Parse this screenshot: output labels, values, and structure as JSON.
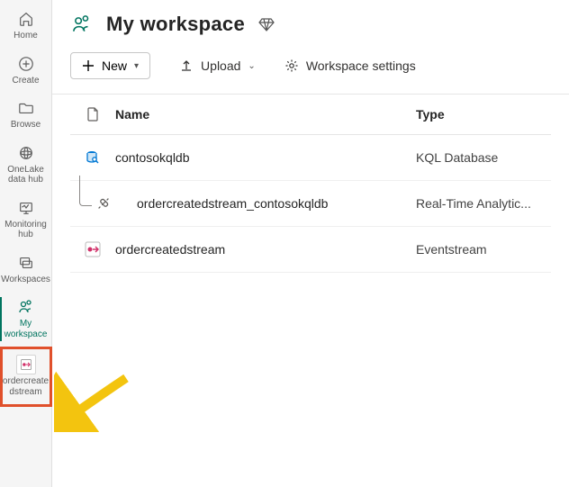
{
  "sidebar": {
    "home": "Home",
    "create": "Create",
    "browse": "Browse",
    "onelake": "OneLake\ndata hub",
    "monitoring": "Monitoring\nhub",
    "workspaces": "Workspaces",
    "myworkspace": "My\nworkspace",
    "ordercreate": "ordercreate\ndstream"
  },
  "header": {
    "title": "My workspace"
  },
  "toolbar": {
    "new": "New",
    "upload": "Upload",
    "settings": "Workspace settings"
  },
  "columns": {
    "name": "Name",
    "type": "Type"
  },
  "rows": [
    {
      "name": "contosokqldb",
      "type": "KQL Database",
      "icon": "kql-database-icon",
      "child": false
    },
    {
      "name": "ordercreatedstream_contosokqldb",
      "type": "Real-Time Analytic...",
      "icon": "plug-icon",
      "child": true
    },
    {
      "name": "ordercreatedstream",
      "type": "Eventstream",
      "icon": "eventstream-icon",
      "child": false
    }
  ]
}
